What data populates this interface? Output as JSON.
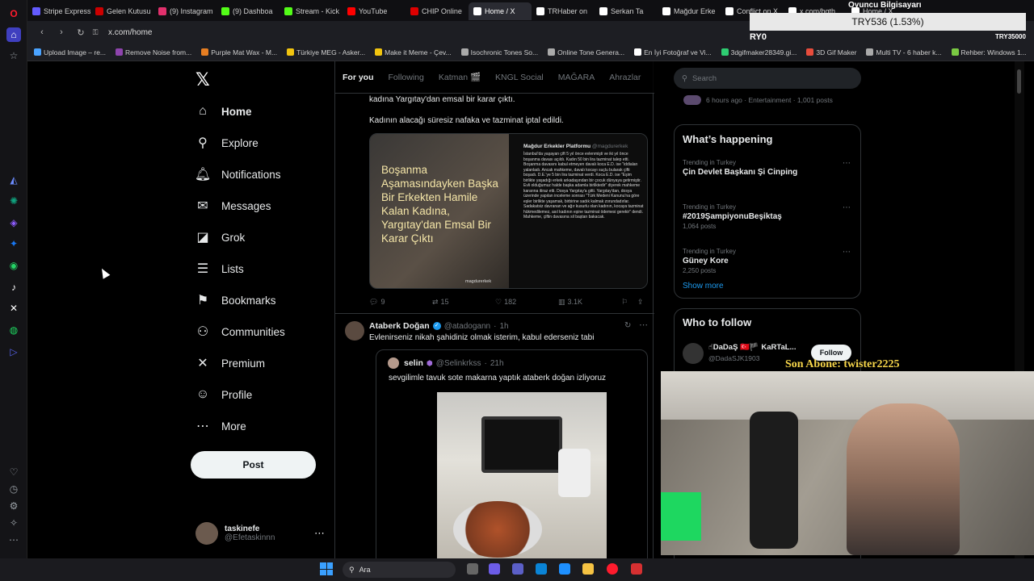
{
  "browser": {
    "tabs": [
      {
        "label": "Stripe Express",
        "color": "#635bff"
      },
      {
        "label": "Gelen Kutusu",
        "color": "#c00"
      },
      {
        "label": "(9) Instagram",
        "color": "#e1306c"
      },
      {
        "label": "(9) Dashboa",
        "color": "#53fc18"
      },
      {
        "label": "Stream - Kick",
        "color": "#53fc18"
      },
      {
        "label": "YouTube",
        "color": "#f00"
      },
      {
        "label": "CHIP Online",
        "color": "#d00"
      },
      {
        "label": "Home / X",
        "color": "#fff",
        "active": true
      },
      {
        "label": "TRHaber on",
        "color": "#fff"
      },
      {
        "label": "Serkan Ta",
        "color": "#fff"
      },
      {
        "label": "Mağdur Erke",
        "color": "#fff"
      },
      {
        "label": "Conflict on X",
        "color": "#fff"
      },
      {
        "label": "x.com/bgth",
        "color": "#fff"
      },
      {
        "label": "Home / X",
        "color": "#fff"
      }
    ],
    "url": "x.com/home",
    "bookmarks": [
      {
        "label": "Upload Image – re...",
        "color": "#4aa3ff"
      },
      {
        "label": "Remove Noise from...",
        "color": "#8e44ad"
      },
      {
        "label": "Purple Mat Wax - M...",
        "color": "#e67e22"
      },
      {
        "label": "Türkiye MEG - Asker...",
        "color": "#f1c40f"
      },
      {
        "label": "Make it Meme - Çev...",
        "color": "#f1c40f"
      },
      {
        "label": "Isochronic Tones So...",
        "color": "#aaa"
      },
      {
        "label": "Online Tone Genera...",
        "color": "#aaa"
      },
      {
        "label": "En İyi Fotoğraf ve Vi...",
        "color": "#fff"
      },
      {
        "label": "3dgifmaker28349.gi...",
        "color": "#2ecc71"
      },
      {
        "label": "3D Gif Maker",
        "color": "#e74c3c"
      },
      {
        "label": "Multi TV - 6 haber k...",
        "color": "#aaa"
      },
      {
        "label": "Rehber: Windows 1...",
        "color": "#7ac943"
      }
    ]
  },
  "nav": {
    "items": [
      {
        "label": "Home",
        "icon": "home-icon",
        "glyph": "⌂"
      },
      {
        "label": "Explore",
        "icon": "search-icon",
        "glyph": "⚲"
      },
      {
        "label": "Notifications",
        "icon": "bell-icon",
        "glyph": "🔔︎"
      },
      {
        "label": "Messages",
        "icon": "envelope-icon",
        "glyph": "✉"
      },
      {
        "label": "Grok",
        "icon": "grok-icon",
        "glyph": "◪"
      },
      {
        "label": "Lists",
        "icon": "list-icon",
        "glyph": "☰"
      },
      {
        "label": "Bookmarks",
        "icon": "bookmark-icon",
        "glyph": "⚑"
      },
      {
        "label": "Communities",
        "icon": "communities-icon",
        "glyph": "⚇"
      },
      {
        "label": "Premium",
        "icon": "x-icon",
        "glyph": "✕"
      },
      {
        "label": "Profile",
        "icon": "profile-icon",
        "glyph": "☺"
      },
      {
        "label": "More",
        "icon": "more-icon",
        "glyph": "⋯"
      }
    ],
    "post_label": "Post",
    "account": {
      "display_name": "taskinefe",
      "handle": "@Efetaskinnn"
    }
  },
  "timeline": {
    "tabs": [
      "For you",
      "Following",
      "Katman 🎬",
      "KNGL Social",
      "MAĞARA",
      "Ahrazlar"
    ],
    "tweet1": {
      "text_line1": "kadına Yargıtay'dan emsal bir karar çıktı.",
      "text_line2": "Kadının alacağı süresiz nafaka ve tazminat iptal edildi.",
      "media_headline": "Boşanma Aşamasındayken Başka Bir Erkekten Hamile Kalan Kadına, Yargıtay'dan Emsal Bir Karar Çıktı",
      "media_source": "Mağdur Erkekler Platformu",
      "media_source_handle": "@magdurerkek",
      "media_body": "İstanbul'da yaşayan çift 5 yıl önce evlenmişti ve iki yıl önce boşanma davası açıldı. Kadın 50 bin lira tazminat talep etti. Boşanma davasını kabul etmeyen davalı koca E.D. ise \"iddiaları yalanladı. Ancak mahkeme, davalı kocayı suçlu bularak çifti boşadı. D.E.'ye 5 bin lira tazminat verdi. Koca E.D. ise \"Eşim birlikte yaşadığı erkek arkadaşından bir çocuk dünyaya getirmiştir. Evli olduğumuz halde başka adamla birliktedir\" diyerek mahkeme kararına itiraz etti. Dosya Yargıtay'a gitti. Yargıtay'dan, dosya üzerinde yapılan inceleme sonrası \"Türk Medeni Kanunu'na göre eşler birlikte yaşamak, birbirine sadık kalmak zorundadırlar. Sadakatsiz davranan ve ağır kusurlu olan kadının, kocaya tazminat hükmedilemez, asıl kadının eşine tazminat ödemesi gerekir\" dendi. Mahkeme, çiftin davasına sil baştan bakacak.",
      "media_footer": "magdurerkek",
      "replies": "9",
      "reposts": "15",
      "likes": "182",
      "views": "3.1K"
    },
    "tweet2": {
      "display_name": "Ataberk Doğan",
      "handle": "@atadogann",
      "time": "1h",
      "text": "Evlenirseniz nikah şahidiniz olmak isterim, kabul ederseniz tabi",
      "quote": {
        "display_name": "selin",
        "handle": "@Selinkrkss",
        "time": "21h",
        "text": "sevgilimle tavuk sote makarna yaptık ataberk doğan izliyoruz"
      }
    }
  },
  "sidebar": {
    "search_placeholder": "Search",
    "spaces_meta": "6 hours ago · Entertainment · 1,001 posts",
    "whats_happening_title": "What’s happening",
    "trends": [
      {
        "context": "Trending in Turkey",
        "name": "Çin Devlet Başkanı Şi Cinping",
        "count": ""
      },
      {
        "context": "Trending in Turkey",
        "name": "#2019ŞampiyonuBeşiktaş",
        "count": "1,064 posts"
      },
      {
        "context": "Trending in Turkey",
        "name": "Güney Kore",
        "count": "2,250 posts"
      }
    ],
    "show_more": "Show more",
    "who_to_follow_title": "Who to follow",
    "follow_suggestion": {
      "display_name": "☝DaDaŞ 🇹🇷🏴 KaRTaL...",
      "handle": "@DadaSJK1903",
      "button": "Follow"
    }
  },
  "stream_overlay": {
    "ticker": "TRY536 (1.53%)",
    "gamer_label": "Oyuncu Bilgisayarı",
    "ryo_label": "RY0",
    "small_ticker": "TRY35000",
    "subscriber": "Son Abone: twister2225"
  },
  "taskbar": {
    "search_label": "Ara"
  },
  "colors": {
    "accent": "#1d9bf0",
    "background": "#000000",
    "border": "#2f3336",
    "muted": "#71767b"
  }
}
